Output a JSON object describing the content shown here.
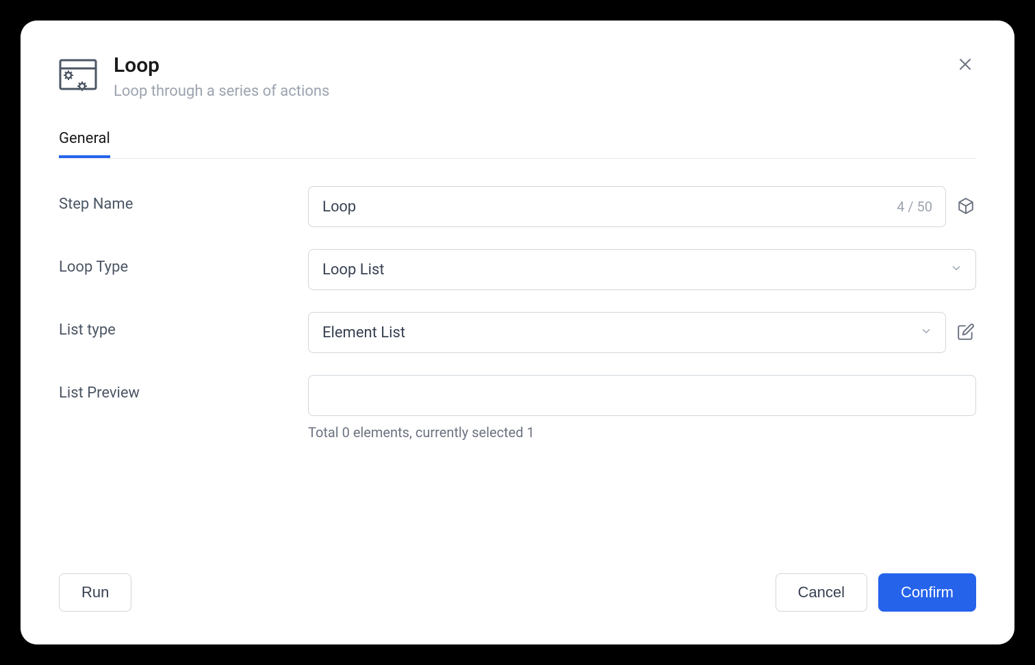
{
  "header": {
    "title": "Loop",
    "subtitle": "Loop through a series of actions"
  },
  "tabs": {
    "general": "General"
  },
  "fields": {
    "step_name": {
      "label": "Step Name",
      "value": "Loop",
      "counter": "4 / 50"
    },
    "loop_type": {
      "label": "Loop Type",
      "value": "Loop List"
    },
    "list_type": {
      "label": "List type",
      "value": "Element List"
    },
    "list_preview": {
      "label": "List Preview",
      "helper": "Total 0 elements, currently selected 1"
    }
  },
  "footer": {
    "run_label": "Run",
    "cancel_label": "Cancel",
    "confirm_label": "Confirm"
  }
}
